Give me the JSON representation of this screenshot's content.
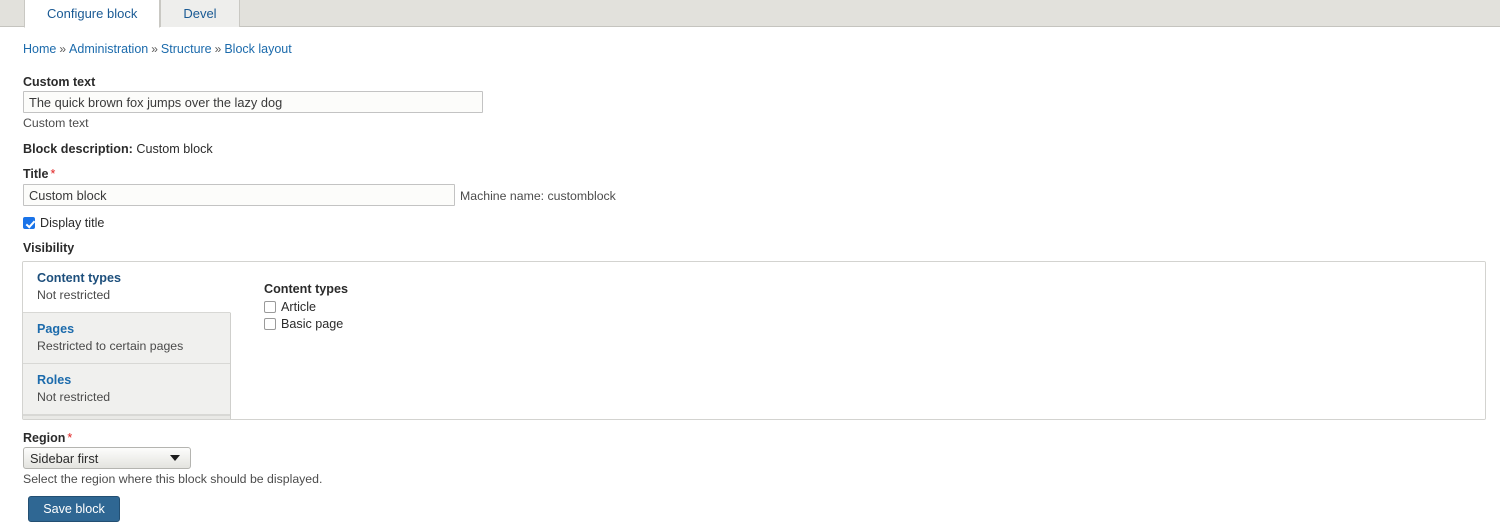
{
  "tabbar": {
    "tabs": [
      {
        "label": "Configure block",
        "active": true
      },
      {
        "label": "Devel",
        "active": false
      }
    ]
  },
  "breadcrumb": {
    "separator": "»",
    "items": [
      {
        "label": "Home"
      },
      {
        "label": "Administration"
      },
      {
        "label": "Structure"
      },
      {
        "label": "Block layout"
      }
    ]
  },
  "form": {
    "custom_text": {
      "label": "Custom text",
      "value": "The quick brown fox jumps over the lazy dog",
      "description": "Custom text"
    },
    "block_description": {
      "label": "Block description:",
      "value": "Custom block"
    },
    "title": {
      "label": "Title",
      "required_marker": "*",
      "value": "Custom block",
      "machine_name": "Machine name: customblock"
    },
    "display_title": {
      "label": "Display title",
      "checked": true
    },
    "visibility": {
      "label": "Visibility",
      "vertical_tabs": [
        {
          "title": "Content types",
          "summary": "Not restricted",
          "selected": true
        },
        {
          "title": "Pages",
          "summary": "Restricted to certain pages",
          "selected": false
        },
        {
          "title": "Roles",
          "summary": "Not restricted",
          "selected": false
        }
      ],
      "pane": {
        "group_title": "Content types",
        "checkboxes": [
          {
            "label": "Article",
            "checked": false
          },
          {
            "label": "Basic page",
            "checked": false
          }
        ]
      }
    },
    "region": {
      "label": "Region",
      "required_marker": "*",
      "selected": "Sidebar first",
      "description": "Select the region where this block should be displayed."
    },
    "save": {
      "label": "Save block"
    }
  }
}
